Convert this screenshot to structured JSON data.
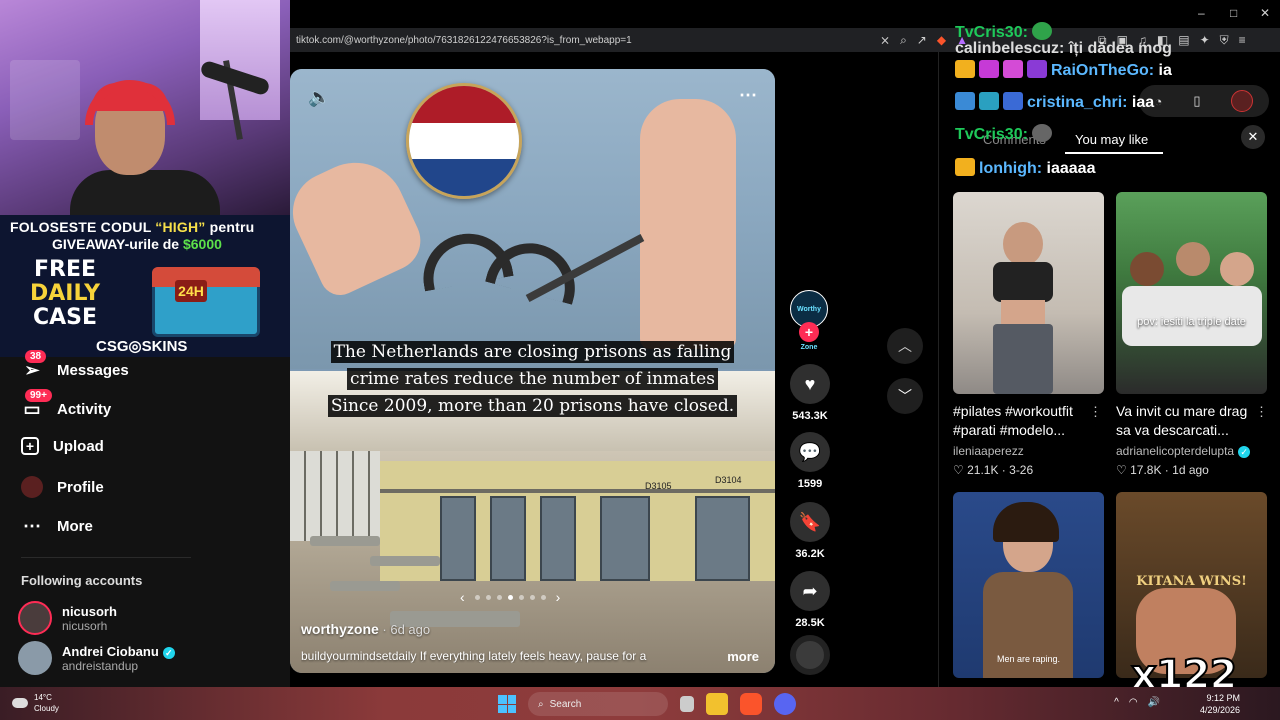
{
  "browser": {
    "url": "tiktok.com/@worthyzone/photo/7631826122476653826?is_from_webapp=1",
    "window_controls": [
      "–",
      "□",
      "✕"
    ]
  },
  "sponsor": {
    "line1_pre": "FOLOSESTE CODUL ",
    "line1_code": "“HIGH”",
    "line1_post": " pentru",
    "line2_pre": "GIVEAWAY-urile de ",
    "line2_amount": "$6000",
    "free": "FREE",
    "daily": "DAILY",
    "case": "CASE",
    "timer": "24H",
    "brand": "CSG◎SKINS",
    "colors": {
      "code": "#f7e04a",
      "amount": "#5de04a"
    }
  },
  "sidebar": {
    "items": [
      {
        "label": "Messages",
        "icon": "paper-plane-icon",
        "badge": "38"
      },
      {
        "label": "Activity",
        "icon": "inbox-icon",
        "badge": "99+"
      },
      {
        "label": "Upload",
        "icon": "plus-square-icon",
        "badge": ""
      },
      {
        "label": "Profile",
        "icon": "avatar-icon",
        "badge": ""
      },
      {
        "label": "More",
        "icon": "ellipsis-icon",
        "badge": ""
      }
    ],
    "following_title": "Following accounts",
    "accounts": [
      {
        "name": "nicusorh",
        "username": "nicusorh",
        "live": true,
        "verified": false
      },
      {
        "name": "Andrei Ciobanu",
        "username": "andreistandup",
        "live": false,
        "verified": true
      }
    ]
  },
  "post": {
    "caption_lines": [
      "The Netherlands are closing prisons as falling",
      "crime rates reduce the number of inmates",
      "Since 2009, more than 20 prisons have closed."
    ],
    "author": "worthyzone",
    "age": " · 6d ago",
    "description": "buildyourmindsetdaily If everything lately feels heavy, pause for a",
    "more_label": "more",
    "cell_labels": [
      "D3105",
      "D3104"
    ],
    "flag_colors": [
      "#ae1c28",
      "#ffffff",
      "#21468b"
    ],
    "carousel_dots": 7,
    "carousel_active": 3
  },
  "actions": {
    "likes": "543.3K",
    "comments": "1599",
    "saves": "36.2K",
    "shares": "28.5K",
    "creator_badge": "Worthy Zone"
  },
  "chat": [
    {
      "user": "TvCris30:",
      "text": "",
      "user_color": "#1ec95a"
    },
    {
      "user": "RaiOnTheGo:",
      "text": " ia",
      "user_color": "#5bb8ff"
    },
    {
      "user": "cristina_chri:",
      "text": " iaa",
      "user_color": "#5bb8ff"
    },
    {
      "user": "TvCris30:",
      "text": "",
      "user_color": "#1ec95a"
    },
    {
      "user": "lonhigh:",
      "text": " iaaaaa",
      "user_color": "#5bb8ff"
    }
  ],
  "chat_top_partial": "calinbelescuz:  îți dădea mog",
  "right_panel": {
    "tab_comments": "Comments",
    "tab_you_may_like": "You may like",
    "cards": [
      {
        "title": "#pilates #workoutfit #parati #modelo...",
        "user": "ileniaaperezz",
        "likes": "21.1K",
        "date": "3-26",
        "verified": false,
        "overlay": ""
      },
      {
        "title": "Va invit cu mare drag sa va descarcati...",
        "user": "adrianelicopterdelupta",
        "likes": "17.8K",
        "date": "1d ago",
        "verified": true,
        "overlay": "pov: iesiti la triple date"
      },
      {
        "title": "",
        "user": "",
        "likes": "",
        "date": "",
        "verified": false,
        "overlay": "Men are raping."
      },
      {
        "title": "",
        "user": "",
        "likes": "",
        "date": "",
        "verified": false,
        "overlay": "KITANA WINS!"
      }
    ],
    "multiplier": "x122"
  },
  "taskbar": {
    "weather_temp": "14°C",
    "weather_desc": "Cloudy",
    "search": "Search",
    "time": "9:12 PM",
    "date": "4/29/2026"
  }
}
